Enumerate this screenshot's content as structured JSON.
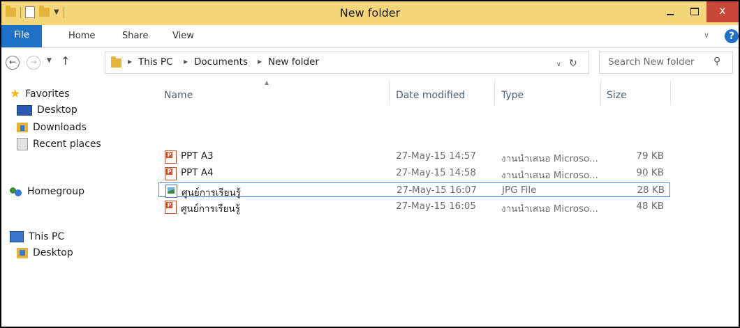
{
  "window": {
    "title": "New folder",
    "minimize_icon": "minimize-icon",
    "maximize_icon": "maximize-icon",
    "close_glyph": "x",
    "close_color": "#c7473a"
  },
  "quick_access": {
    "icons": [
      "folder-icon",
      "properties-icon",
      "new-folder-icon",
      "customize-toolbar-icon"
    ]
  },
  "ribbon": {
    "tabs": [
      {
        "label": "File",
        "active": true,
        "color": "#1e72c6"
      },
      {
        "label": "Home"
      },
      {
        "label": "Share"
      },
      {
        "label": "View"
      }
    ],
    "expand_icon": "chevron-down-icon",
    "help_glyph": "?"
  },
  "address_bar": {
    "breadcrumbs": [
      "This PC",
      "Documents",
      "New folder"
    ],
    "dropdown_icon": "chevron-down-icon",
    "refresh_icon": "refresh-icon"
  },
  "search": {
    "placeholder": "Search New folder",
    "icon": "search-icon"
  },
  "nav_pane": {
    "items": [
      {
        "label": "Favorites",
        "icon": "star-icon"
      },
      {
        "label": "Desktop",
        "icon": "desktop-icon"
      },
      {
        "label": "Downloads",
        "icon": "downloads-icon"
      },
      {
        "label": "Recent places",
        "icon": "recent-places-icon"
      },
      {
        "label": "Homegroup",
        "icon": "homegroup-icon"
      },
      {
        "label": "This PC",
        "icon": "computer-icon"
      },
      {
        "label": "Desktop",
        "icon": "desktop-folder-icon"
      }
    ]
  },
  "file_list": {
    "columns": [
      "Name",
      "Date modified",
      "Type",
      "Size"
    ],
    "sort_column": "Name",
    "rows": [
      {
        "name": "PPT A3",
        "date": "27-May-15 14:57",
        "type": "งานนำเสนอ Microso...",
        "size": "79 KB",
        "icon": "powerpoint-file-icon"
      },
      {
        "name": "PPT A4",
        "date": "27-May-15 14:58",
        "type": "งานนำเสนอ Microso...",
        "size": "90 KB",
        "icon": "powerpoint-file-icon"
      },
      {
        "name": "ศูนย์การเรียนรู้",
        "date": "27-May-15 16:07",
        "type": "JPG File",
        "size": "28 KB",
        "icon": "image-file-icon",
        "selected": true
      },
      {
        "name": "ศูนย์การเรียนรู้",
        "date": "27-May-15 16:05",
        "type": "งานนำเสนอ Microso...",
        "size": "48 KB",
        "icon": "powerpoint-file-icon"
      }
    ]
  }
}
